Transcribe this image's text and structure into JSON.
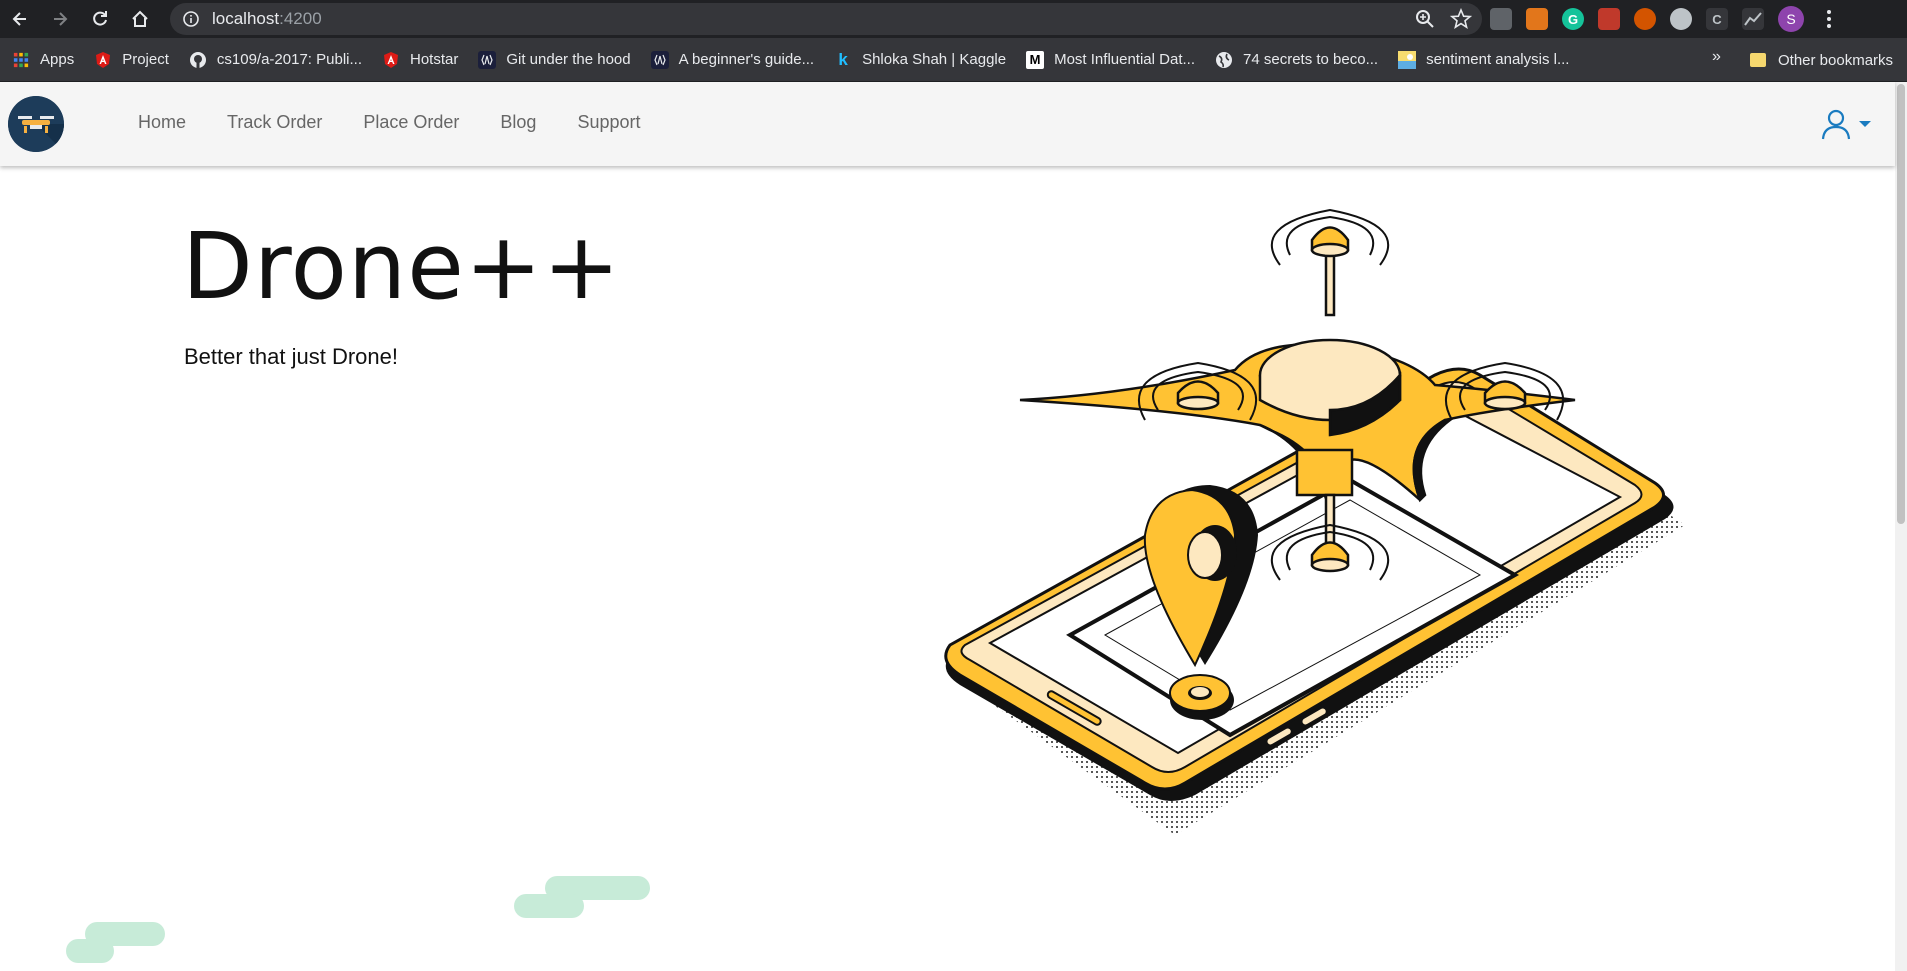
{
  "browser": {
    "url_host": "localhost",
    "url_port": ":4200",
    "profile_initial": "S"
  },
  "bookmarks": [
    {
      "label": "Apps",
      "icon": "apps-grid-icon"
    },
    {
      "label": "Project",
      "icon": "angular-icon"
    },
    {
      "label": "cs109/a-2017: Publi...",
      "icon": "github-icon"
    },
    {
      "label": "Hotstar",
      "icon": "angular-icon"
    },
    {
      "label": "Git under the hood",
      "icon": "bracket-icon"
    },
    {
      "label": "A beginner's guide...",
      "icon": "bracket-icon"
    },
    {
      "label": "Shloka Shah | Kaggle",
      "icon": "kaggle-icon"
    },
    {
      "label": "Most Influential Dat...",
      "icon": "medium-icon"
    },
    {
      "label": "74 secrets to beco...",
      "icon": "globe-icon"
    },
    {
      "label": "sentiment analysis l...",
      "icon": "image-icon"
    }
  ],
  "bookmarks_more": "»",
  "other_bookmarks": "Other bookmarks",
  "app": {
    "nav": [
      "Home",
      "Track Order",
      "Place Order",
      "Blog",
      "Support"
    ],
    "hero_title": "Drone++",
    "hero_subtitle": "Better that just Drone!"
  },
  "colors": {
    "accent_yellow": "#ffc233",
    "light_yellow": "#fde8c0",
    "outline": "#111111",
    "user_icon_blue": "#1a7bc0",
    "blob_green": "#c7ebd8"
  }
}
